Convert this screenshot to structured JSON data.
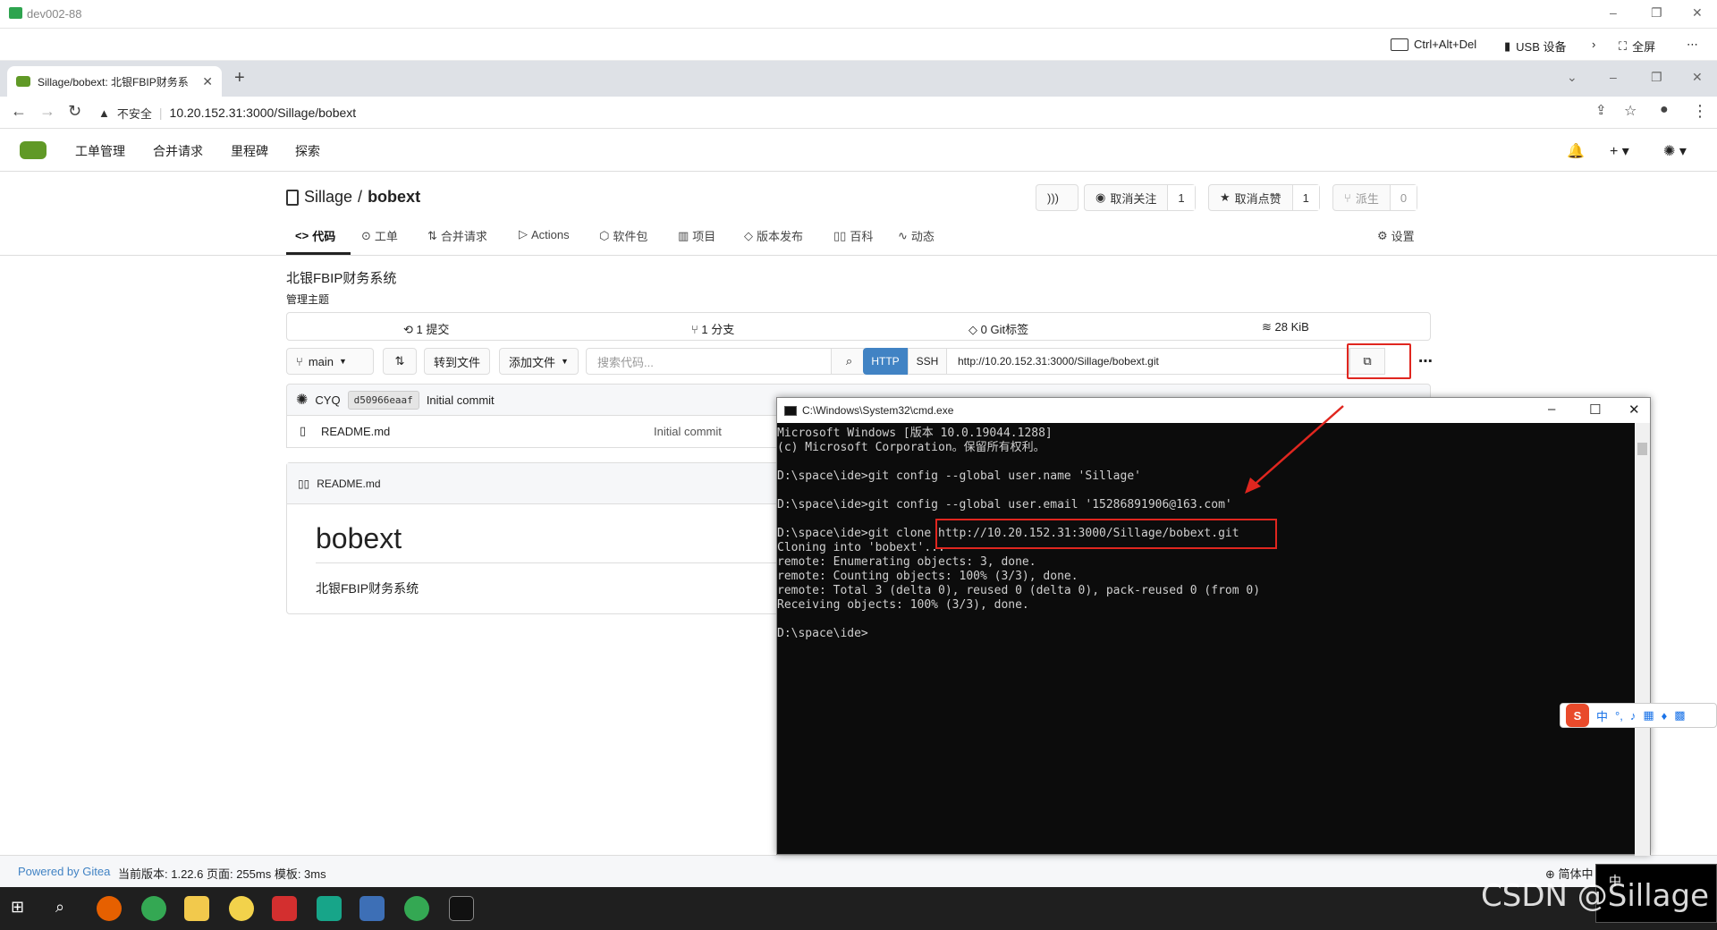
{
  "remote_desktop": {
    "title": "dev002-88",
    "tools": [
      "Ctrl+Alt+Del",
      "USB 设备",
      "全屏"
    ]
  },
  "browser": {
    "tab_title": "Sillage/bobext: 北银FBIP财务系",
    "security_label": "不安全",
    "url": "10.20.152.31:3000/Sillage/bobext"
  },
  "gitea_nav": {
    "items": [
      "工单管理",
      "合并请求",
      "里程碑",
      "探索"
    ]
  },
  "repo": {
    "owner": "Sillage",
    "separator": "/",
    "name": "bobext",
    "buttons": {
      "unwatch": "取消关注",
      "watch_count": "1",
      "unstar": "取消点赞",
      "star_count": "1",
      "fork": "派生",
      "fork_count": "0"
    },
    "tabs": [
      "代码",
      "工单",
      "合并请求",
      "Actions",
      "软件包",
      "项目",
      "版本发布",
      "百科",
      "动态"
    ],
    "settings": "设置",
    "description": "北银FBIP财务系统",
    "topic": "管理主题",
    "stats": {
      "commits": "1 提交",
      "branches": "1 分支",
      "tags": "0 Git标签",
      "size": "28 KiB"
    },
    "toolbar": {
      "branch": "main",
      "goto_file": "转到文件",
      "add_file": "添加文件",
      "search_placeholder": "搜索代码...",
      "http": "HTTP",
      "ssh": "SSH",
      "clone_url": "http://10.20.152.31:3000/Sillage/bobext.git"
    },
    "latest_commit": {
      "author": "CYQ",
      "sha": "d50966eaaf",
      "message": "Initial commit"
    },
    "files": [
      {
        "name": "README.md",
        "commit": "Initial commit"
      }
    ],
    "readme": {
      "filename": "README.md",
      "heading": "bobext",
      "body": "北银FBIP财务系统"
    }
  },
  "footer": {
    "powered": "Powered by Gitea",
    "version": "当前版本: 1.22.6 页面: 255ms 模板: 3ms",
    "language": "简体中"
  },
  "cmd": {
    "title": "C:\\Windows\\System32\\cmd.exe",
    "text": "Microsoft Windows [版本 10.0.19044.1288]\n(c) Microsoft Corporation。保留所有权利。\n\nD:\\space\\ide>git config --global user.name 'Sillage'\n\nD:\\space\\ide>git config --global user.email '15286891906@163.com'\n\nD:\\space\\ide>git clone http://10.20.152.31:3000/Sillage/bobext.git\nCloning into 'bobext'...\nremote: Enumerating objects: 3, done.\nremote: Counting objects: 100% (3/3), done.\nremote: Total 3 (delta 0), reused 0 (delta 0), pack-reused 0 (from 0)\nReceiving objects: 100% (3/3), done.\n\nD:\\space\\ide>"
  },
  "ime": {
    "mode": "中"
  },
  "watermark": "CSDN @Sillage",
  "colors": {
    "gitea_green": "#609926",
    "accent_blue": "#4183c4",
    "highlight_red": "#e0261f"
  }
}
